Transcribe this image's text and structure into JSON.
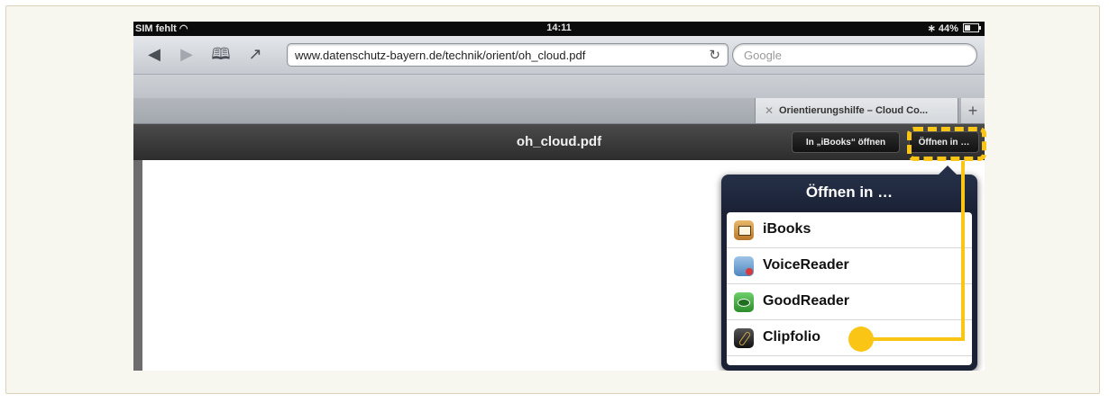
{
  "status_bar": {
    "carrier": "SIM fehlt",
    "time": "14:11",
    "battery": "44%"
  },
  "toolbar": {
    "url": "www.datenschutz-bayern.de/technik/orient/oh_cloud.pdf",
    "search_placeholder": "Google"
  },
  "tabs": [
    {
      "title": "Orientierungshilfe – Cloud Co..."
    }
  ],
  "pdf_bar": {
    "title": "oh_cloud.pdf",
    "ibooks_button": "In „iBooks“ öffnen",
    "open_in_button": "Öffnen in …"
  },
  "popover": {
    "title": "Öffnen in …",
    "apps": [
      {
        "label": "iBooks",
        "icon": "ibooks-icon"
      },
      {
        "label": "VoiceReader",
        "icon": "voicereader-icon"
      },
      {
        "label": "GoodReader",
        "icon": "goodreader-icon"
      },
      {
        "label": "Clipfolio",
        "icon": "clipfolio-icon"
      }
    ]
  },
  "annotation": {
    "color": "#fbc516"
  }
}
